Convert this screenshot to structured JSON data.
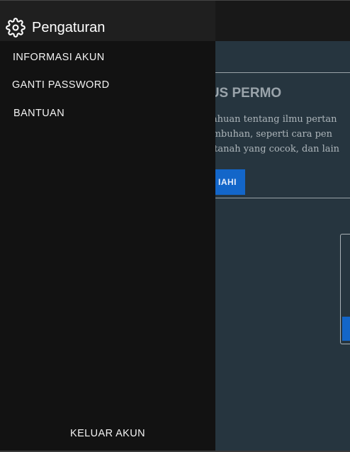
{
  "background": {
    "card_title": "MUS PERMO",
    "card_lines": [
      "etahuan tentang ilmu pertan",
      "tumbuhan, seperti cara pen",
      "k, tanah yang cocok, dan lain"
    ],
    "card_button_label": "IAHI"
  },
  "drawer": {
    "title": "Pengaturan",
    "icon": "gear-icon",
    "items": [
      {
        "label": "INFORMASI AKUN"
      },
      {
        "label": "GANTI PASSWORD"
      },
      {
        "label": "BANTUAN"
      }
    ],
    "logout_label": "KELUAR AKUN"
  },
  "colors": {
    "drawer_bg": "#121212",
    "drawer_header_bg": "#1f1f1f",
    "app_bg": "#26353f",
    "accent": "#1366c9"
  }
}
